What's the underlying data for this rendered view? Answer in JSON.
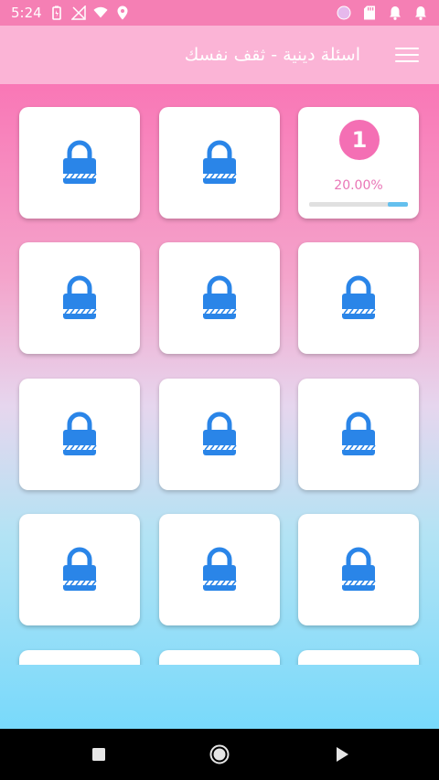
{
  "status_bar": {
    "time": "5:24",
    "icons_left": [
      "battery-saver-icon",
      "no-signal-icon",
      "wifi-icon",
      "location-icon"
    ],
    "icons_right": [
      "circle-icon",
      "sd-card-icon",
      "notification-icon",
      "notification-icon"
    ]
  },
  "app_bar": {
    "title": "اسئلة دينية - ثقف نفسك",
    "menu_icon": "menu-icon"
  },
  "levels": {
    "level_number": "1",
    "progress_text": "20.00%",
    "progress_fraction": 0.2,
    "locked_icon": "lock-icon"
  },
  "colors": {
    "status_bar": "#f57fb4",
    "app_bar": "#fbb4d6",
    "accent_pink": "#f46fb4",
    "lock_blue": "#2a85e8",
    "progress": "#64c0ee"
  },
  "nav_bar": {
    "icons": [
      "recents-icon",
      "home-icon",
      "back-icon"
    ]
  }
}
